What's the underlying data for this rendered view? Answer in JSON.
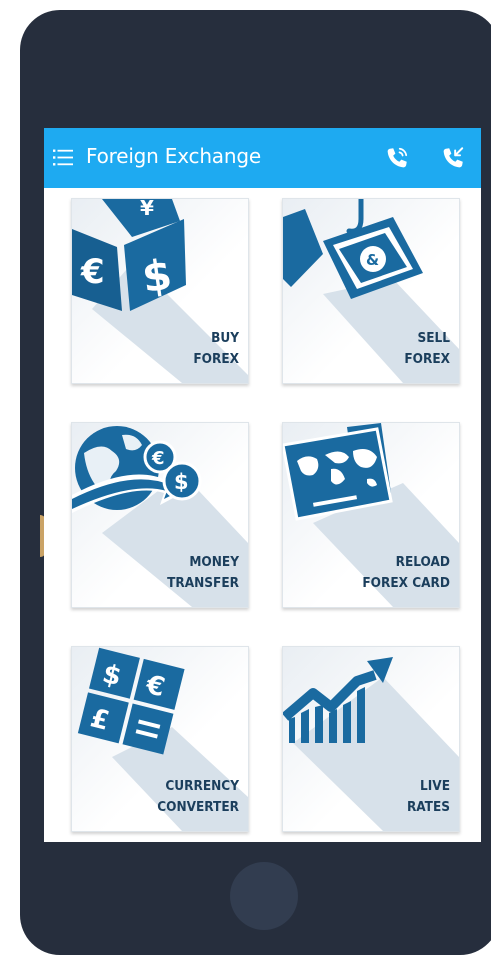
{
  "app": {
    "title": "Foreign Exchange",
    "icons": {
      "menu": "menu-icon",
      "call": "phone-call-icon",
      "callback": "phone-callback-icon"
    }
  },
  "colors": {
    "app_bar": "#1eaaf1",
    "phone_body": "#262e3d",
    "tile_art": "#1a6aa0",
    "tile_text": "#1b3e5c"
  },
  "tiles": [
    {
      "icon": "currency-dice-icon",
      "line1": "BUY",
      "line2": "FOREX"
    },
    {
      "icon": "banknote-hook-icon",
      "line1": "SELL",
      "line2": "FOREX"
    },
    {
      "icon": "globe-transfer-icon",
      "line1": "MONEY",
      "line2": "TRANSFER"
    },
    {
      "icon": "world-map-card-icon",
      "line1": "RELOAD",
      "line2": "FOREX CARD"
    },
    {
      "icon": "currency-calculator-icon",
      "line1": "CURRENCY",
      "line2": "CONVERTER"
    },
    {
      "icon": "rising-chart-icon",
      "line1": "LIVE",
      "line2": "RATES"
    }
  ]
}
